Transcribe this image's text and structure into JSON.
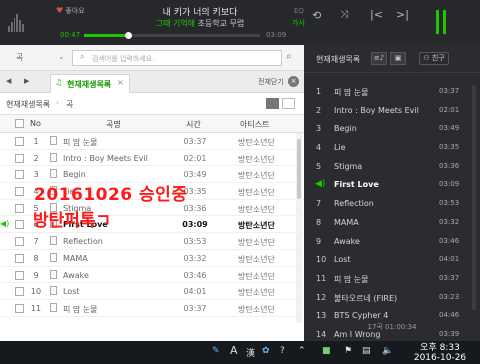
{
  "player": {
    "like_label": "좋아요",
    "eq_label": "EQ",
    "song_title": "내 키가 너의 키보다",
    "lyric_prev": "그때 기억해",
    "lyric_cur": "초등학교 무렵",
    "lyrics_label": "가사",
    "elapsed": "00:47",
    "duration": "03:09",
    "progress": 0.25
  },
  "search": {
    "type": "곡",
    "placeholder": "검색어를 입력하세요.",
    "caret": "⌄"
  },
  "tabs": {
    "active_label": "현재재생목록",
    "close_all_label": "전체닫기"
  },
  "breadcrumb": {
    "root": "현재재생목록",
    "sub": "곡"
  },
  "table": {
    "headers": {
      "no": "No",
      "title": "곡명",
      "time": "시간",
      "artist": "아티스트"
    },
    "rows": [
      {
        "no": "1",
        "title": "피 땀 눈물",
        "time": "03:37",
        "artist": "방탄소년단"
      },
      {
        "no": "2",
        "title": "Intro : Boy Meets Evil",
        "time": "02:01",
        "artist": "방탄소년단"
      },
      {
        "no": "3",
        "title": "Begin",
        "time": "03:49",
        "artist": "방탄소년단"
      },
      {
        "no": "4",
        "title": "Lie",
        "time": "03:35",
        "artist": "방탄소년단"
      },
      {
        "no": "5",
        "title": "Stigma",
        "time": "03:36",
        "artist": "방탄소년단"
      },
      {
        "no": "6",
        "title": "First Love",
        "time": "03:09",
        "artist": "방탄소년단",
        "playing": true
      },
      {
        "no": "7",
        "title": "Reflection",
        "time": "03:53",
        "artist": "방탄소년단"
      },
      {
        "no": "8",
        "title": "MAMA",
        "time": "03:32",
        "artist": "방탄소년단"
      },
      {
        "no": "9",
        "title": "Awake",
        "time": "03:46",
        "artist": "방탄소년단"
      },
      {
        "no": "10",
        "title": "Lost",
        "time": "04:01",
        "artist": "방탄소년단"
      },
      {
        "no": "11",
        "title": "피 땀 눈물",
        "time": "03:37",
        "artist": "방탄소년단"
      }
    ]
  },
  "overlay": {
    "line1": "20161026 승인중",
    "line2": "방탄퍼톡ㄱ"
  },
  "now_playing": {
    "title": "현재재생목록",
    "friend_label": "친구",
    "items": [
      {
        "no": "1",
        "title": "피 땀 눈물",
        "time": "03:37"
      },
      {
        "no": "2",
        "title": "Intro : Boy Meets Evil",
        "time": "02:01"
      },
      {
        "no": "3",
        "title": "Begin",
        "time": "03:49"
      },
      {
        "no": "4",
        "title": "Lie",
        "time": "03:35"
      },
      {
        "no": "5",
        "title": "Stigma",
        "time": "03:36"
      },
      {
        "no": "6",
        "title": "First Love",
        "time": "03:09",
        "playing": true
      },
      {
        "no": "7",
        "title": "Reflection",
        "time": "03:53"
      },
      {
        "no": "8",
        "title": "MAMA",
        "time": "03:32"
      },
      {
        "no": "9",
        "title": "Awake",
        "time": "03:46"
      },
      {
        "no": "10",
        "title": "Lost",
        "time": "04:01"
      },
      {
        "no": "11",
        "title": "피 땀 눈물",
        "time": "03:37"
      },
      {
        "no": "12",
        "title": "불타오르네 (FIRE)",
        "time": "03:23"
      },
      {
        "no": "13",
        "title": "BTS Cypher 4",
        "time": "04:46"
      },
      {
        "no": "14",
        "title": "Am I Wrong",
        "time": "03:39"
      }
    ],
    "footer": "17곡 01:00:34"
  },
  "taskbar": {
    "ime_mode": "A",
    "ime_hanja": "漢",
    "time": "오후 8:33",
    "date": "2016-10-26"
  },
  "colors": {
    "accent": "#1ec800",
    "overlay": "#ff1a1a"
  }
}
